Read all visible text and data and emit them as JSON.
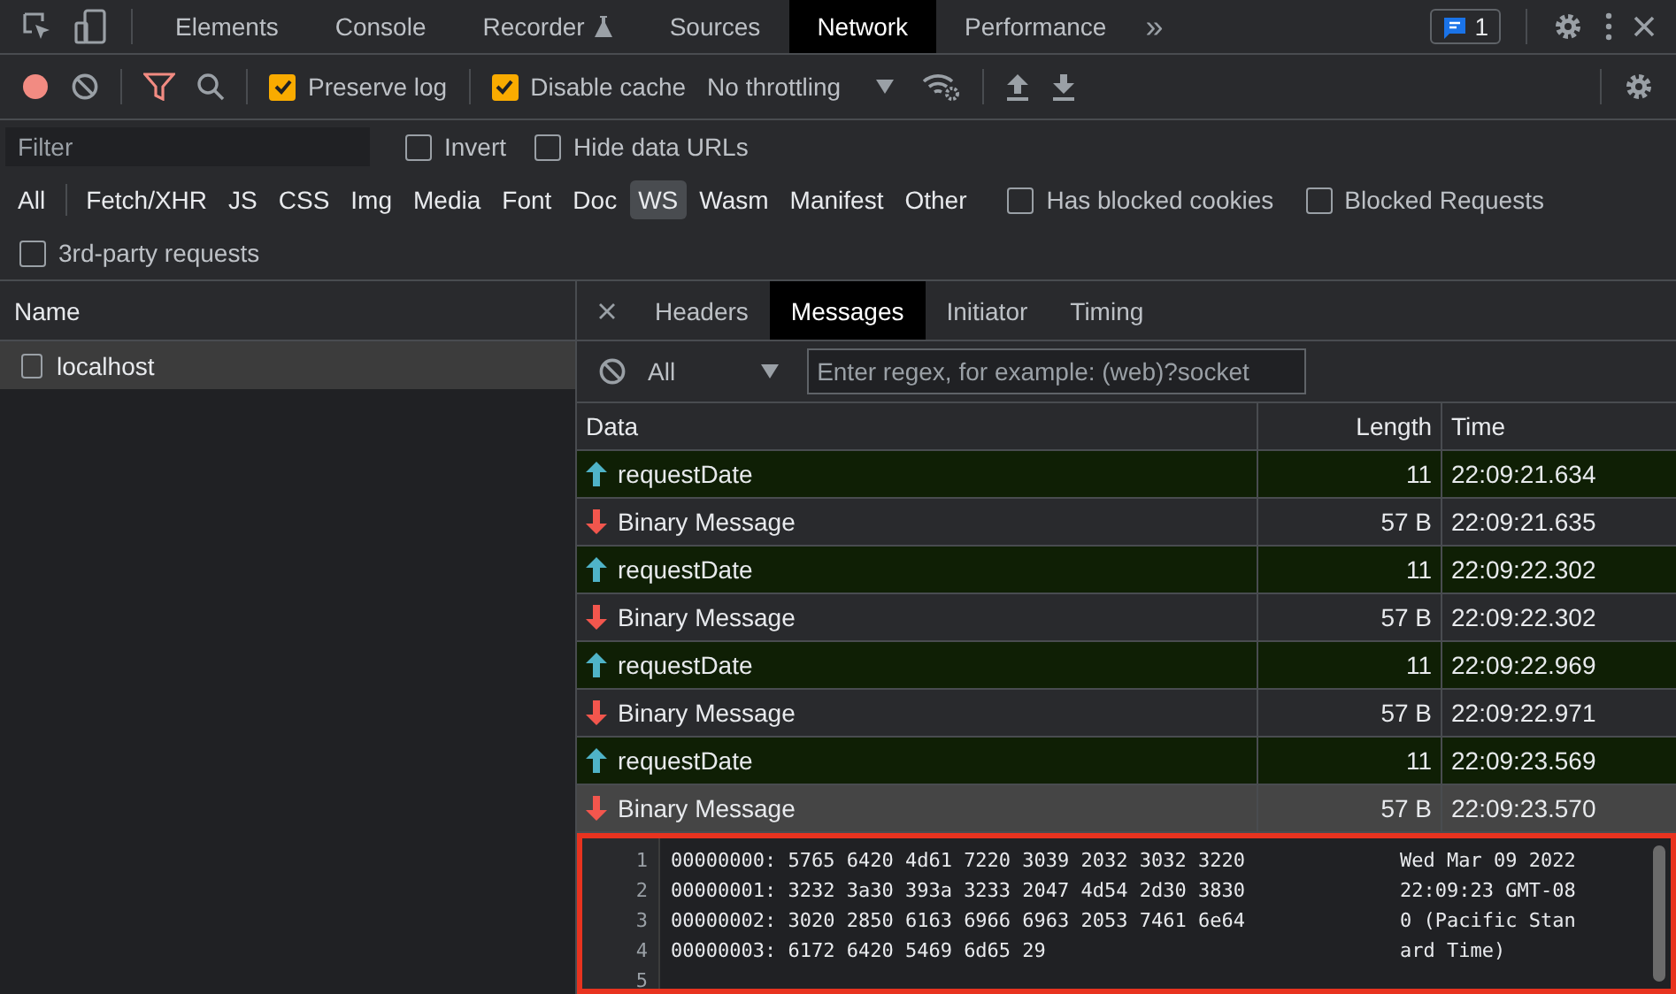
{
  "main_tabs": [
    {
      "label": "Elements",
      "selected": false
    },
    {
      "label": "Console",
      "selected": false
    },
    {
      "label": "Recorder",
      "selected": false,
      "kind": "experimental"
    },
    {
      "label": "Sources",
      "selected": false
    },
    {
      "label": "Network",
      "selected": true
    },
    {
      "label": "Performance",
      "selected": false
    }
  ],
  "more_tabs": "»",
  "issues_badge": "1",
  "toolbar": {
    "checkboxes": [
      {
        "label": "Preserve log",
        "checked": true
      },
      {
        "label": "Disable cache",
        "checked": true
      }
    ],
    "throttling": "No throttling"
  },
  "filter": {
    "placeholder": "Filter",
    "options": [
      {
        "label": "Invert",
        "checked": false
      },
      {
        "label": "Hide data URLs",
        "checked": false
      }
    ]
  },
  "types": [
    {
      "label": "All",
      "selected": false
    },
    {
      "label": "Fetch/XHR",
      "selected": false
    },
    {
      "label": "JS",
      "selected": false
    },
    {
      "label": "CSS",
      "selected": false
    },
    {
      "label": "Img",
      "selected": false
    },
    {
      "label": "Media",
      "selected": false
    },
    {
      "label": "Font",
      "selected": false
    },
    {
      "label": "Doc",
      "selected": false
    },
    {
      "label": "WS",
      "selected": true
    },
    {
      "label": "Wasm",
      "selected": false
    },
    {
      "label": "Manifest",
      "selected": false
    },
    {
      "label": "Other",
      "selected": false
    }
  ],
  "type_options": [
    {
      "label": "Has blocked cookies",
      "checked": false
    },
    {
      "label": "Blocked Requests",
      "checked": false
    }
  ],
  "third_party": {
    "label": "3rd-party requests",
    "checked": false
  },
  "requests": {
    "header": "Name",
    "rows": [
      {
        "name": "localhost",
        "selected": true,
        "checked": false
      }
    ]
  },
  "detail_tabs": [
    {
      "label": "Headers",
      "selected": false
    },
    {
      "label": "Messages",
      "selected": true
    },
    {
      "label": "Initiator",
      "selected": false
    },
    {
      "label": "Timing",
      "selected": false
    }
  ],
  "message_filter": {
    "select": "All",
    "placeholder": "Enter regex, for example: (web)?socket"
  },
  "messages": {
    "columns": [
      "Data",
      "Length",
      "Time"
    ],
    "rows": [
      {
        "kind": "sent",
        "data": "requestDate",
        "length": "11",
        "time": "22:09:21.634",
        "selected": false
      },
      {
        "kind": "received",
        "data": "Binary Message",
        "length": "57 B",
        "time": "22:09:21.635",
        "selected": false
      },
      {
        "kind": "sent",
        "data": "requestDate",
        "length": "11",
        "time": "22:09:22.302",
        "selected": false
      },
      {
        "kind": "received",
        "data": "Binary Message",
        "length": "57 B",
        "time": "22:09:22.302",
        "selected": false
      },
      {
        "kind": "sent",
        "data": "requestDate",
        "length": "11",
        "time": "22:09:22.969",
        "selected": false
      },
      {
        "kind": "received",
        "data": "Binary Message",
        "length": "57 B",
        "time": "22:09:22.971",
        "selected": false
      },
      {
        "kind": "sent",
        "data": "requestDate",
        "length": "11",
        "time": "22:09:23.569",
        "selected": false
      },
      {
        "kind": "received",
        "data": "Binary Message",
        "length": "57 B",
        "time": "22:09:23.570",
        "selected": true
      }
    ]
  },
  "hex_view": {
    "lines": [
      {
        "number": "1",
        "hex": "00000000: 5765 6420 4d61 7220 3039 2032 3032 3220",
        "ascii": "Wed Mar 09 2022"
      },
      {
        "number": "2",
        "hex": "00000001: 3232 3a30 393a 3233 2047 4d54 2d30 3830",
        "ascii": "22:09:23 GMT-08"
      },
      {
        "number": "3",
        "hex": "00000002: 3020 2850 6163 6966 6963 2053 7461 6e64",
        "ascii": "0 (Pacific Stan"
      },
      {
        "number": "4",
        "hex": "00000003: 6172 6420 5469 6d65 29",
        "ascii": "ard Time)"
      },
      {
        "number": "5"
      }
    ]
  }
}
